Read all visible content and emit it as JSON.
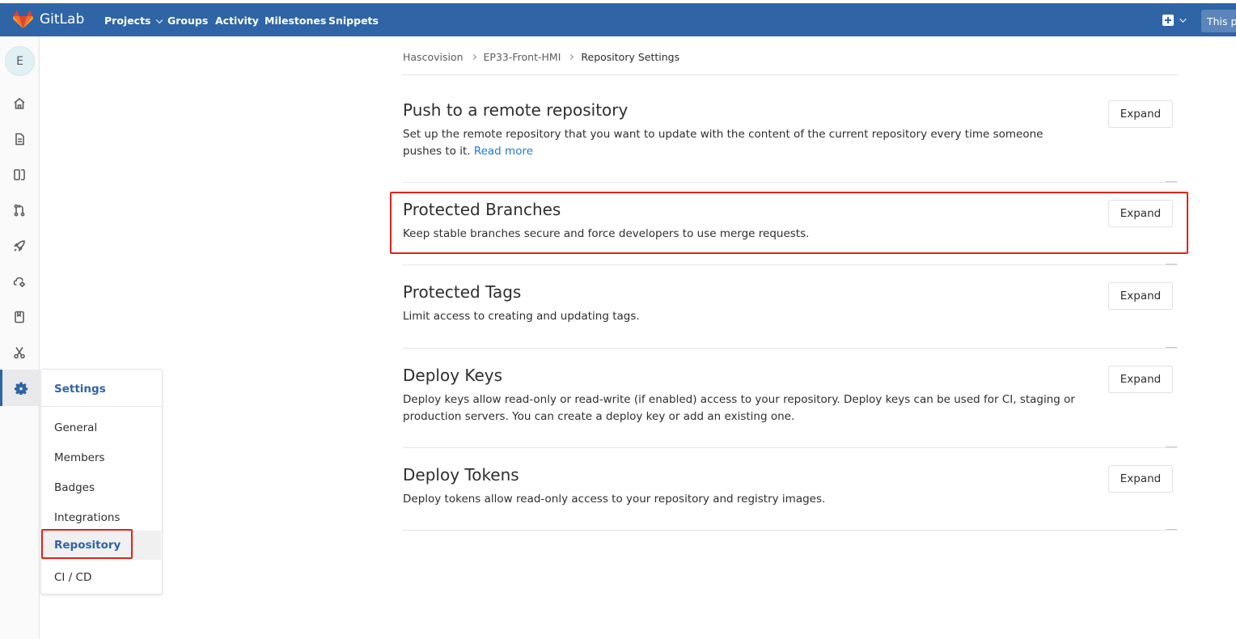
{
  "topbar": {
    "brand": "GitLab",
    "nav": [
      "Projects",
      "Groups",
      "Activity",
      "Milestones",
      "Snippets"
    ],
    "search_text": "This pr"
  },
  "sidebar": {
    "avatar_letter": "E",
    "icons": [
      "home-icon",
      "issues-icon",
      "boards-icon",
      "merge-request-icon",
      "rocket-icon",
      "operations-icon",
      "wiki-icon",
      "snippets-icon",
      "settings-icon"
    ]
  },
  "flyout": {
    "title": "Settings",
    "items": [
      "General",
      "Members",
      "Badges",
      "Integrations",
      "Repository",
      "CI / CD"
    ],
    "active": "Repository"
  },
  "breadcrumb": [
    "Hascovision",
    "EP33-Front-HMI",
    "Repository Settings"
  ],
  "sections": [
    {
      "title": "Push to a remote repository",
      "desc": "Set up the remote repository that you want to update with the content of the current repository every time someone pushes to it.",
      "link": "Read more",
      "button": "Expand"
    },
    {
      "title": "Protected Branches",
      "desc": "Keep stable branches secure and force developers to use merge requests.",
      "button": "Expand"
    },
    {
      "title": "Protected Tags",
      "desc": "Limit access to creating and updating tags.",
      "button": "Expand"
    },
    {
      "title": "Deploy Keys",
      "desc": "Deploy keys allow read-only or read-write (if enabled) access to your repository. Deploy keys can be used for CI, staging or production servers. You can create a deploy key or add an existing one.",
      "button": "Expand"
    },
    {
      "title": "Deploy Tokens",
      "desc": "Deploy tokens allow read-only access to your repository and registry images.",
      "button": "Expand"
    }
  ],
  "colors": {
    "navbar": "#2f64a6",
    "link": "#1f78d1",
    "highlight": "#e3231c"
  }
}
